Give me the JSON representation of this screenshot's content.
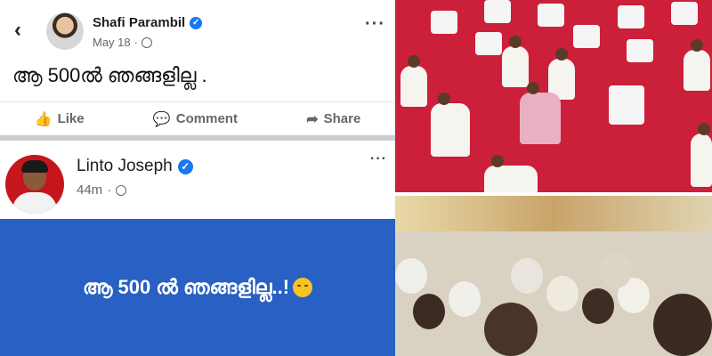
{
  "post1": {
    "author": "Shafi Parambil",
    "date": "May 18",
    "meta_sep": "·",
    "text": "ആ 500ൽ ഞങ്ങളില്ല .",
    "actions": {
      "like": "Like",
      "comment": "Comment",
      "share": "Share"
    }
  },
  "post2": {
    "author": "Linto Joseph",
    "time": "44m",
    "meta_sep": "·",
    "image_text": "ആ 500 ൽ ഞങ്ങളില്ല..!"
  },
  "icons": {
    "back": "‹",
    "more": "···",
    "like": "👍",
    "comment": "💬",
    "share": "➦",
    "verified": "✓"
  },
  "colors": {
    "verified_blue": "#1877f2",
    "card_blue": "#2860c4",
    "carpet_red": "#cc1f3a"
  }
}
